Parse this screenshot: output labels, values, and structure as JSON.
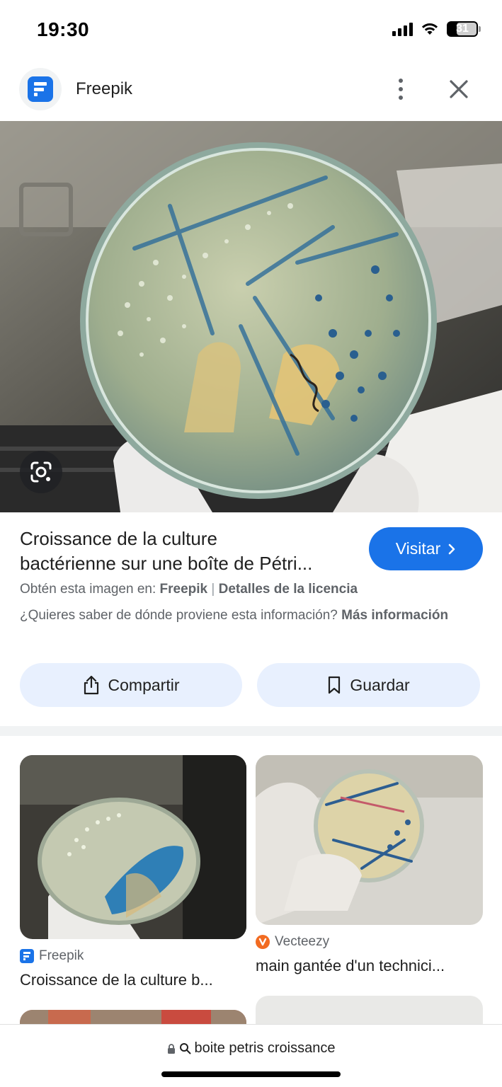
{
  "status_bar": {
    "time": "19:30",
    "battery": "31"
  },
  "header": {
    "site_name": "Freepik",
    "logo_icon": "freepik-logo",
    "menu_icon": "more-vert-icon",
    "close_icon": "close-icon"
  },
  "result": {
    "title_line1": "Croissance de la culture",
    "title_line2": "bactérienne sur une boîte de Pétri...",
    "visit_label": "Visitar",
    "source_prefix": "Obtén esta imagen en:",
    "source_name": "Freepik",
    "source_separator": "|",
    "license_link": "Detalles de la licencia",
    "info_question": "¿Quieres saber de dónde proviene esta información?",
    "info_link": "Más información"
  },
  "actions": {
    "share_label": "Compartir",
    "save_label": "Guardar"
  },
  "related": [
    {
      "source": "Freepik",
      "title": "Croissance de la culture b..."
    },
    {
      "source": "Vecteezy",
      "title": "main gantée d'un technici..."
    }
  ],
  "address_bar": {
    "text": "boite petris croissance"
  },
  "colors": {
    "accent": "#1a73e8",
    "button_bg": "#e8f0fe",
    "secondary_text": "#5f6368"
  }
}
